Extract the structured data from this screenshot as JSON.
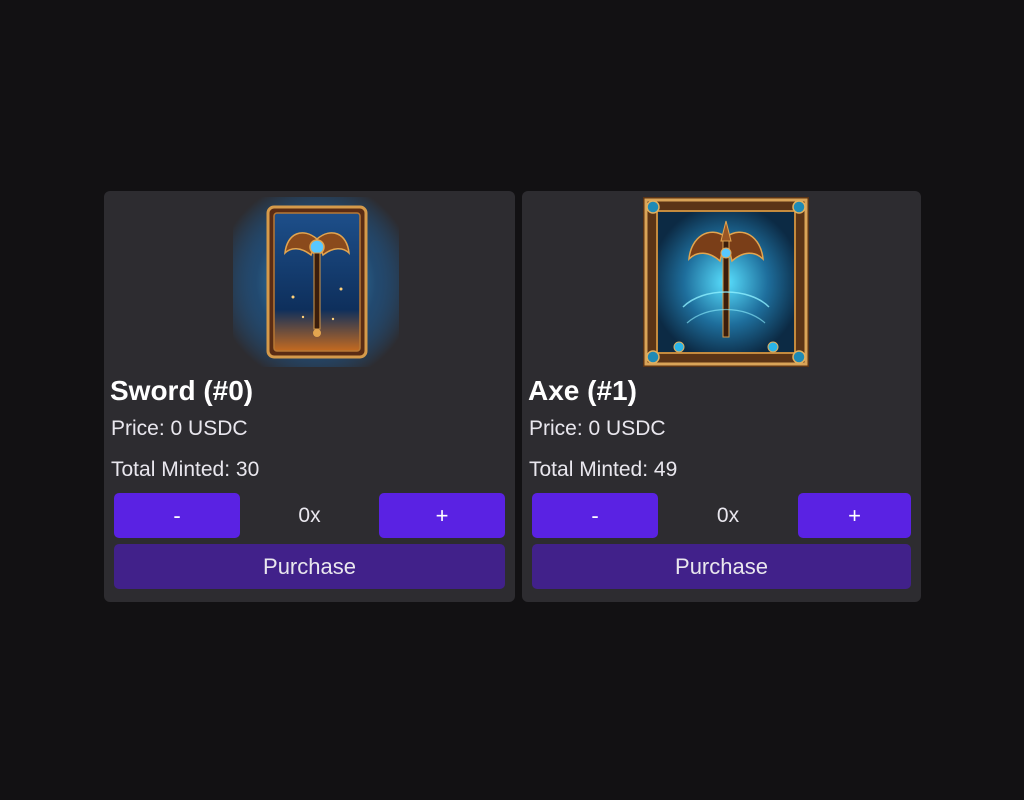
{
  "items": [
    {
      "title": "Sword (#0)",
      "price": "Price: 0 USDC",
      "minted": "Total Minted: 30",
      "minus_label": "-",
      "quantity": "0x",
      "plus_label": "+",
      "purchase_label": "Purchase",
      "image_icon": "double-axe-card-icon"
    },
    {
      "title": "Axe (#1)",
      "price": "Price: 0 USDC",
      "minted": "Total Minted: 49",
      "minus_label": "-",
      "quantity": "0x",
      "plus_label": "+",
      "purchase_label": "Purchase",
      "image_icon": "ornate-axe-card-icon"
    }
  ],
  "colors": {
    "background": "#121113",
    "card": "#2d2c30",
    "button": "#5a22e3",
    "purchase": "#41218a"
  }
}
